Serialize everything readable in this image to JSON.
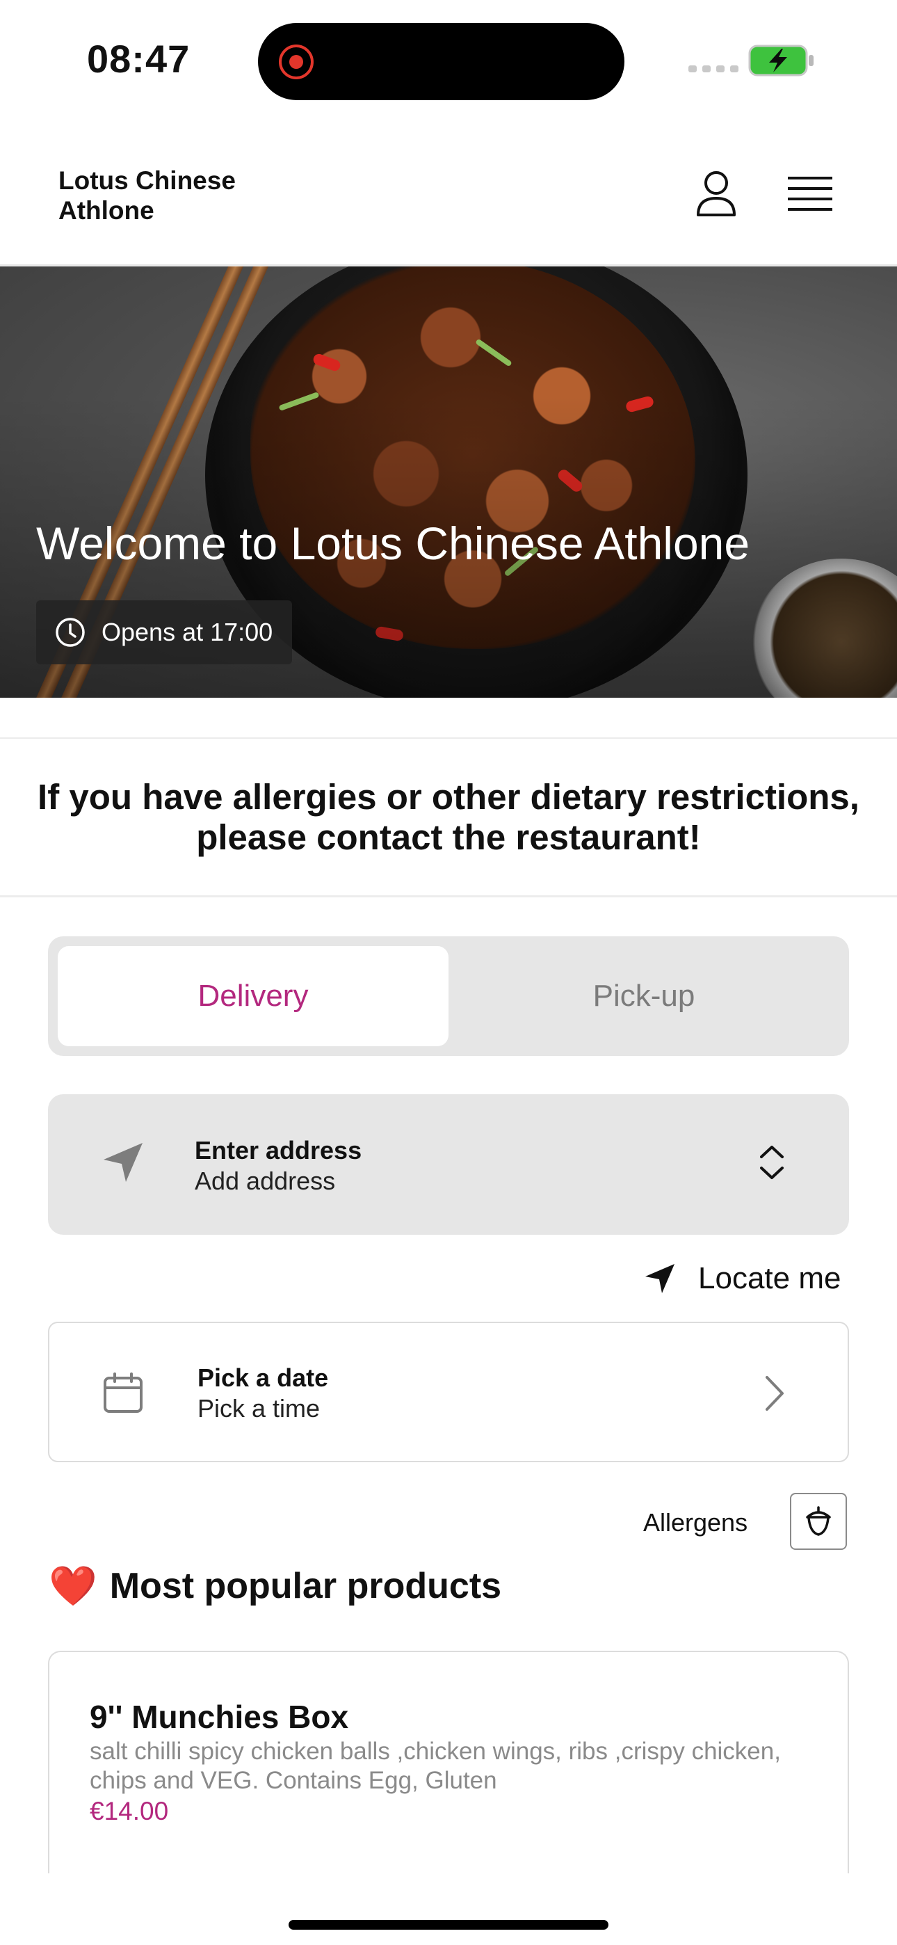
{
  "status_bar": {
    "time": "08:47",
    "icons": [
      "screen-recording-icon",
      "signal-icon",
      "battery-charging-icon"
    ],
    "battery_color": "#3ec23e"
  },
  "header": {
    "brand": "Lotus Chinese\nAthlone",
    "icons": [
      "user-icon",
      "menu-icon"
    ]
  },
  "hero": {
    "title": "Welcome to Lotus Chinese Athlone",
    "hours_icon": "clock-icon",
    "hours": "Opens at 17:00"
  },
  "notice": {
    "text": "If you have allergies or other dietary restrictions,\nplease contact the restaurant!"
  },
  "order_mode": {
    "options": [
      "Delivery",
      "Pick-up"
    ],
    "selected": "Delivery",
    "accent_color": "#b3287e"
  },
  "address": {
    "icon": "navigation-arrow-icon",
    "title": "Enter address",
    "value": "Add address",
    "toggle_icon": "chevron-up-down-icon"
  },
  "locate": {
    "icon": "location-arrow-icon",
    "label": "Locate me"
  },
  "schedule": {
    "icon": "calendar-icon",
    "title": "Pick a date",
    "value": "Pick a time",
    "chevron_icon": "chevron-right-icon"
  },
  "allergens": {
    "label": "Allergens",
    "icon": "acorn-icon"
  },
  "popular": {
    "emoji": "❤️",
    "title": "Most popular products",
    "products": [
      {
        "name": "9'' Munchies Box",
        "description": "salt chilli spicy chicken balls ,chicken wings, ribs ,crispy chicken, chips and VEG.  Contains Egg, Gluten",
        "price": "€14.00"
      }
    ]
  }
}
